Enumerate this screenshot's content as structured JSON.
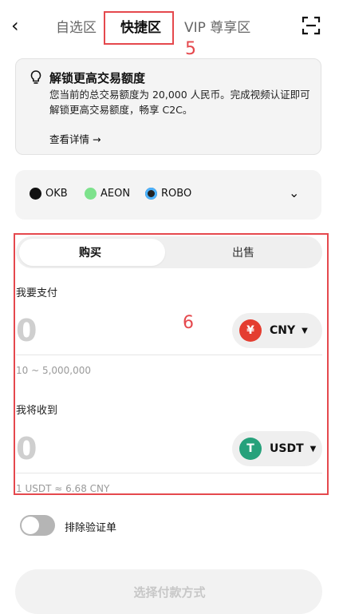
{
  "header": {
    "back_icon": "chevron-left-icon",
    "tabs": [
      {
        "label": "自选区",
        "active": false
      },
      {
        "label": "快捷区",
        "active": true
      },
      {
        "label": "VIP 尊享区",
        "active": false
      }
    ],
    "scan_icon": "scan-icon",
    "annotation_5": "5"
  },
  "notice": {
    "icon": "lightbulb-icon",
    "title": "解锁更高交易额度",
    "body": "您当前的总交易额度为 20,000 人民币。完成视频认证即可解锁更高交易额度，畅享 C2C。",
    "link": "查看详情 →"
  },
  "coins": {
    "items": [
      {
        "label": "OKB",
        "color": "#111111"
      },
      {
        "label": "AEON",
        "color": "#7de28c"
      },
      {
        "label": "ROBO",
        "color": "#222222"
      }
    ],
    "expand_icon": "chevron-down-icon"
  },
  "trade": {
    "annotation_6": "6",
    "segments": {
      "buy": "购买",
      "sell": "出售"
    },
    "pay": {
      "label": "我要支付",
      "amount": "0",
      "currency": "CNY",
      "currency_symbol": "¥",
      "currency_color": "#e43d30",
      "range_hint": "10 ~ 5,000,000"
    },
    "receive": {
      "label": "我将收到",
      "amount": "0",
      "currency": "USDT",
      "currency_symbol": "T",
      "currency_color": "#26a17b",
      "rate_hint": "1 USDT ≈ 6.68 CNY"
    }
  },
  "exclude_toggle": {
    "label": "排除验证单",
    "on": false
  },
  "cta": {
    "label": "选择付款方式"
  }
}
